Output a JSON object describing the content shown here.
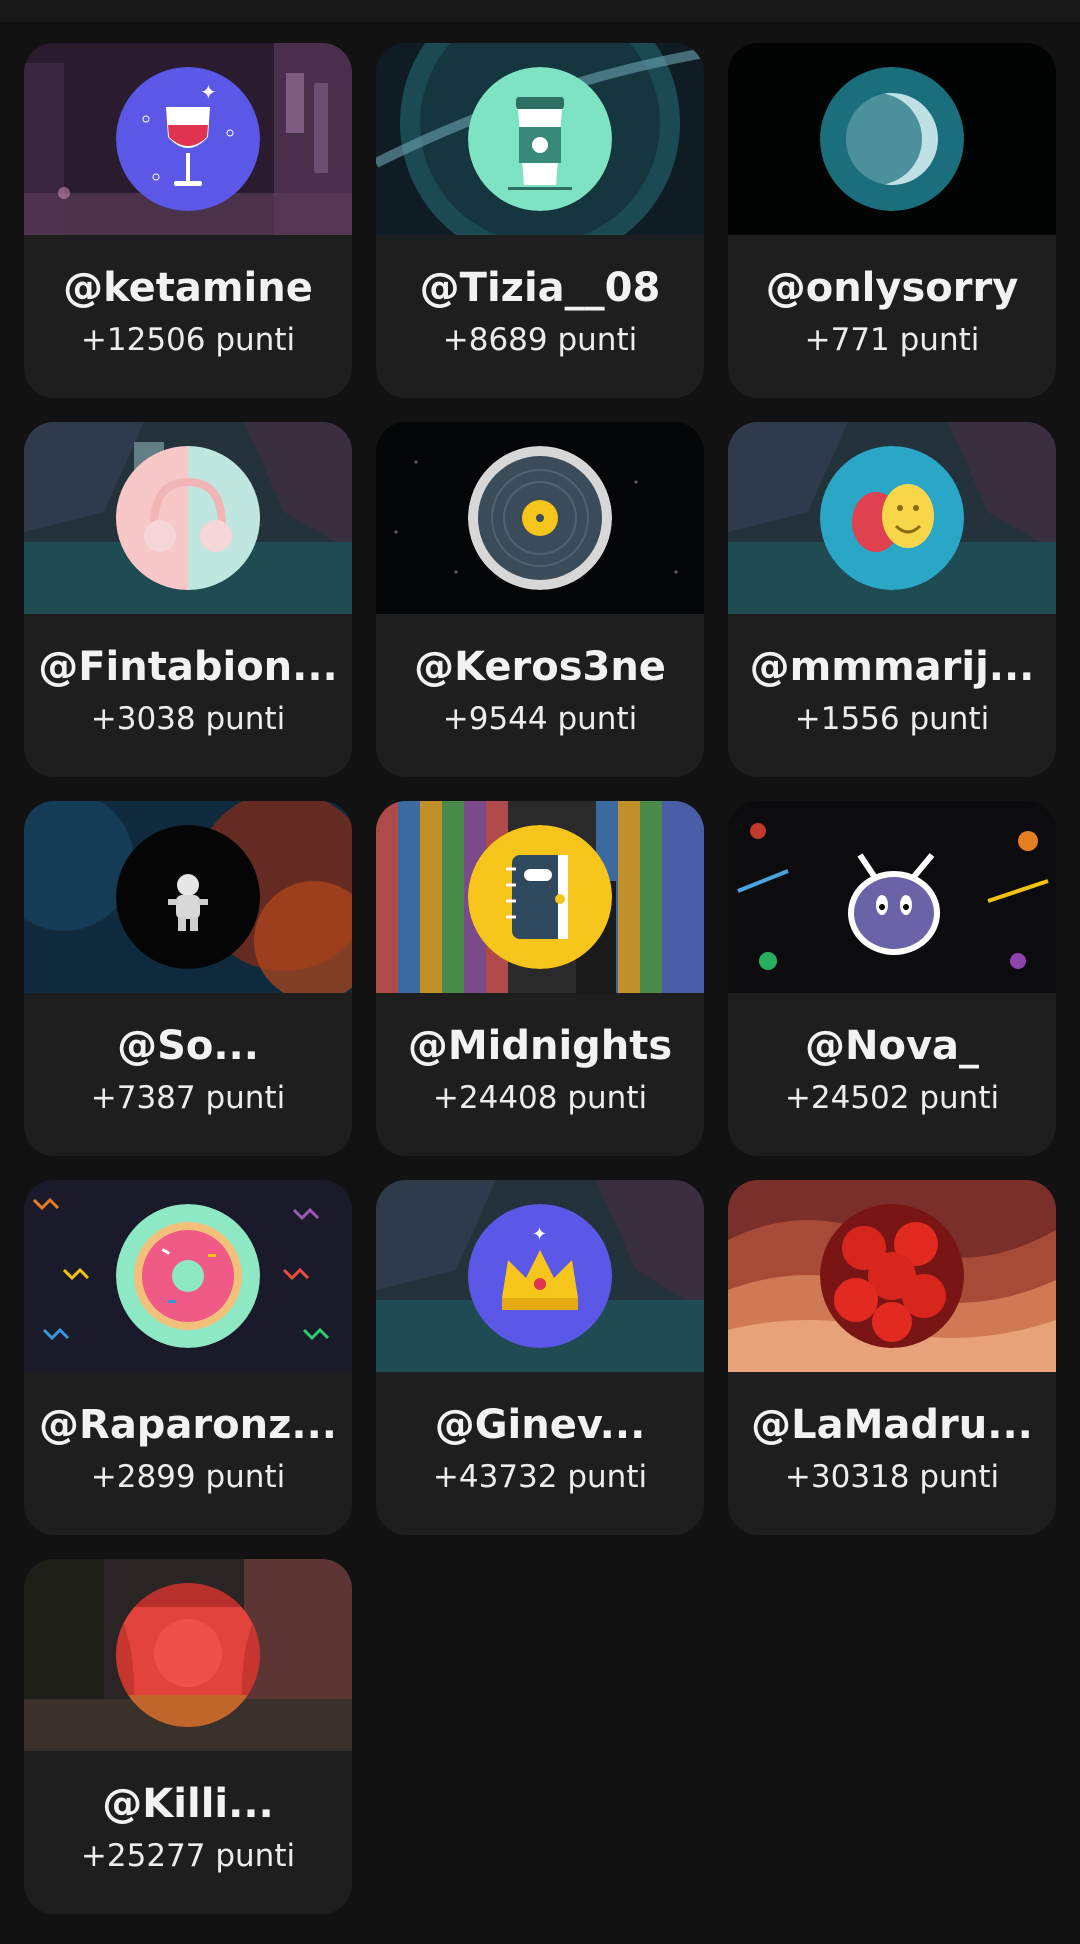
{
  "users": [
    {
      "name": "@ketamine",
      "points": "+12506 punti",
      "avatar_icon": "wine-glass-icon",
      "banner": "city-night"
    },
    {
      "name": "@Tizia__08",
      "points": "+8689 punti",
      "avatar_icon": "coffee-cup-icon",
      "banner": "planet"
    },
    {
      "name": "@onlysorry",
      "points": "+771 punti",
      "avatar_icon": "moon-icon",
      "banner": "space"
    },
    {
      "name": "@Fintabion...",
      "points": "+3038 punti",
      "avatar_icon": "headphones-icon",
      "banner": "waterfall"
    },
    {
      "name": "@Keros3ne",
      "points": "+9544 punti",
      "avatar_icon": "vinyl-record-icon",
      "banner": "starfield"
    },
    {
      "name": "@mmmarij...",
      "points": "+1556 punti",
      "avatar_icon": "theater-masks-icon",
      "banner": "waterfall"
    },
    {
      "name": "@So...",
      "points": "+7387 punti",
      "avatar_icon": "astronaut-icon",
      "banner": "smoke"
    },
    {
      "name": "@Midnights",
      "points": "+24408 punti",
      "avatar_icon": "notebook-icon",
      "banner": "stripes"
    },
    {
      "name": "@Nova_",
      "points": "+24502 punti",
      "avatar_icon": "alien-icon",
      "banner": "space-doodles"
    },
    {
      "name": "@Raparonz...",
      "points": "+2899 punti",
      "avatar_icon": "donut-icon",
      "banner": "zigzag"
    },
    {
      "name": "@Ginev...",
      "points": "+43732 punti",
      "avatar_icon": "crown-icon",
      "banner": "waterfall"
    },
    {
      "name": "@LaMadru...",
      "points": "+30318 punti",
      "avatar_icon": "strawberries-icon",
      "banner": "desert-red"
    },
    {
      "name": "@Killi...",
      "points": "+25277 punti",
      "avatar_icon": "theater-stage-icon",
      "banner": "forest-dusk"
    }
  ]
}
